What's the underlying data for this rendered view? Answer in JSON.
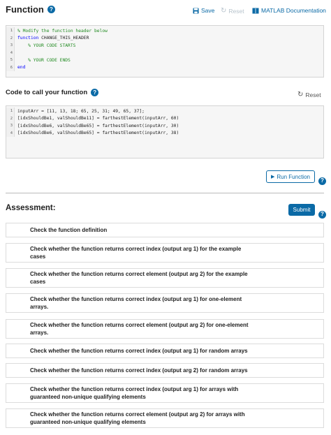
{
  "function_section": {
    "title": "Function",
    "save_label": "Save",
    "reset_label": "Reset",
    "docs_label": "MATLAB Documentation",
    "code_lines": [
      {
        "num": "1",
        "segments": [
          {
            "t": "% Modify the function header below",
            "c": "cm"
          }
        ]
      },
      {
        "num": "2",
        "segments": [
          {
            "t": "function",
            "c": "kw"
          },
          {
            "t": " CHANGE_THIS_HEADER",
            "c": ""
          }
        ]
      },
      {
        "num": "3",
        "segments": [
          {
            "t": "    % YOUR CODE STARTS",
            "c": "cm"
          }
        ]
      },
      {
        "num": "4",
        "segments": [
          {
            "t": "",
            "c": ""
          }
        ]
      },
      {
        "num": "5",
        "segments": [
          {
            "t": "    % YOUR CODE ENDS",
            "c": "cm"
          }
        ]
      },
      {
        "num": "6",
        "segments": [
          {
            "t": "end",
            "c": "kw"
          }
        ]
      }
    ]
  },
  "call_section": {
    "title": "Code to call your function",
    "reset_label": "Reset",
    "code_lines": [
      {
        "num": "1",
        "segments": [
          {
            "t": "inputArr = [11, 13, 18; 65, 25, 31; 49, 65, 37];",
            "c": ""
          }
        ]
      },
      {
        "num": "2",
        "segments": [
          {
            "t": "[idxShouldBe1, valShouldBe11] = farthestElement(inputArr, 60)",
            "c": ""
          }
        ]
      },
      {
        "num": "3",
        "segments": [
          {
            "t": "[idxShouldBe6, valShouldBe65] = farthestElement(inputArr, 30)",
            "c": ""
          }
        ]
      },
      {
        "num": "4",
        "segments": [
          {
            "t": "[idxShouldBe6, valShouldBe65] = farthestElement(inputArr, 38)",
            "c": ""
          }
        ]
      }
    ],
    "run_label": "Run Function"
  },
  "assessment": {
    "title": "Assessment:",
    "submit_label": "Submit",
    "checks": [
      "Check the function definition",
      "Check whether the function returns correct index (output arg 1) for the example cases",
      "Check whether the function returns correct element (output arg 2) for the example cases",
      "Check whether the function returns correct index (output arg 1) for one-element arrays.",
      "Check whether the function returns correct element (output arg 2) for one-element arrays.",
      "Check whether the function returns correct index (output arg 1) for random arrays",
      "Check whether the function returns correct index (output arg 2) for random arrays",
      "Check whether the function returns correct index (output arg 1) for arrays with guaranteed non-unique qualifying elements",
      "Check whether the function returns correct element (output arg 2) for arrays with guaranteed non-unique qualifying elements"
    ]
  },
  "colors": {
    "accent": "#0b6aa6",
    "comment": "#228b22",
    "keyword": "#0000ff"
  }
}
